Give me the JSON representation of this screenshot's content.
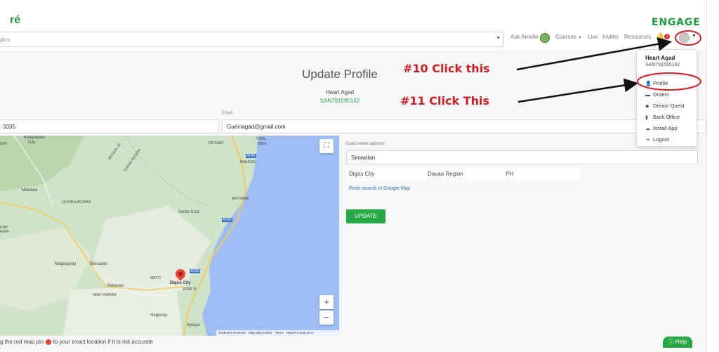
{
  "header": {
    "logo_left": "ré",
    "logo_right": "ENGAGE",
    "search_placeholder": "pics",
    "nav": {
      "ask": "Ask Amelie",
      "courses": "Courses",
      "live": "Live",
      "invites": "Invites",
      "resources": "Resources",
      "bell_badge": "1"
    }
  },
  "profile": {
    "title": "Update Profile",
    "name": "Heart Agad",
    "code": "SAN791595162",
    "email_label": "Email",
    "phone_value": "3335",
    "email_value": "Gueinagad@gmail.com"
  },
  "map": {
    "labels": {
      "kidapawan": "Kidapawan",
      "city": "City",
      "gay": "GAY",
      "region_xii": "REGION XII",
      "davao_region": "DAVAO REGION",
      "catigan": "CATIGAN",
      "toril": "TORIL",
      "zada": "ZADA",
      "bingaas": "BINUGAO",
      "ah26_a": "AH26",
      "makilala": "Makilala",
      "old_bulatukan": "OLD BULATUKAN",
      "astorga": "ASTORGA",
      "ah26_b": "AH26",
      "santa_cruz": "Santa Cruz",
      "iday": "IDAY",
      "igor": "IGOR",
      "magsaysay": "Magsaysay",
      "bansalan": "Bansalan",
      "matti": "MATTI",
      "ah26_c": "AH26",
      "matanao": "Matanao",
      "digos_city": "Digos City",
      "zone_iii": "ZONE III",
      "new_visayas": "NEW VISAYAS",
      "hagonoy": "Hagonoy",
      "aplaya": "Aplaya"
    },
    "fullscreen_icon": "⛶",
    "zoom_in": "+",
    "zoom_out": "−",
    "footer": {
      "shortcuts": "Keyboard shortcuts",
      "data": "Map data ©2023",
      "terms": "Terms",
      "report": "Report a map error"
    }
  },
  "address": {
    "label": "Exact street address",
    "street": "Sinawilan",
    "city": "Digos City",
    "region": "Davao Region",
    "country": "PH",
    "redo_link": "Redo search in Google Map",
    "update_button": "UPDATE"
  },
  "footer": {
    "note_prefix": "g the red map pin",
    "note_suffix": "to your exact location if it is not accurate",
    "help": "Help"
  },
  "dropdown": {
    "name": "Heart Agad",
    "code": "SAN791595162",
    "items": [
      {
        "label": "Profile",
        "icon": "person-icon"
      },
      {
        "label": "Orders",
        "icon": "orders-icon"
      },
      {
        "label": "Dream Quest",
        "icon": "diamond-icon"
      },
      {
        "label": "Back Office",
        "icon": "office-icon"
      },
      {
        "label": "Install App",
        "icon": "cloud-download-icon"
      },
      {
        "label": "Logout",
        "icon": "logout-icon"
      }
    ]
  },
  "annotations": {
    "step10": "#10 Click this",
    "step11": "#11 Click This"
  },
  "colors": {
    "accent_green": "#28a745",
    "annotation_red": "#d71d20",
    "link_blue": "#2f6fb3"
  }
}
